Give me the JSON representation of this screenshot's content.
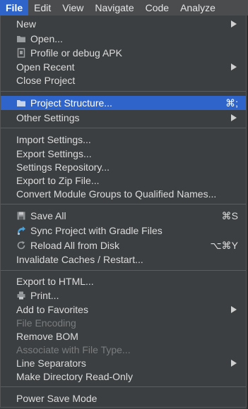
{
  "menubar": {
    "items": [
      "File",
      "Edit",
      "View",
      "Navigate",
      "Code",
      "Analyze"
    ]
  },
  "menu": {
    "new": "New",
    "open": "Open...",
    "profile_apk": "Profile or debug APK",
    "open_recent": "Open Recent",
    "close_project": "Close Project",
    "project_structure": "Project Structure...",
    "project_structure_shortcut": "⌘;",
    "other_settings": "Other Settings",
    "import_settings": "Import Settings...",
    "export_settings": "Export Settings...",
    "settings_repository": "Settings Repository...",
    "export_zip": "Export to Zip File...",
    "convert_module_groups": "Convert Module Groups to Qualified Names...",
    "save_all": "Save All",
    "save_all_shortcut": "⌘S",
    "sync_gradle": "Sync Project with Gradle Files",
    "reload_disk": "Reload All from Disk",
    "reload_disk_shortcut": "⌥⌘Y",
    "invalidate_caches": "Invalidate Caches / Restart...",
    "export_html": "Export to HTML...",
    "print": "Print...",
    "add_favorites": "Add to Favorites",
    "file_encoding": "File Encoding",
    "remove_bom": "Remove BOM",
    "associate_file_type": "Associate with File Type...",
    "line_separators": "Line Separators",
    "make_readonly": "Make Directory Read-Only",
    "power_save": "Power Save Mode"
  },
  "colors": {
    "background": "#3c3f41",
    "selection": "#2f65ca",
    "text": "#dcdcdc",
    "disabled_text": "#7a7c7e"
  }
}
